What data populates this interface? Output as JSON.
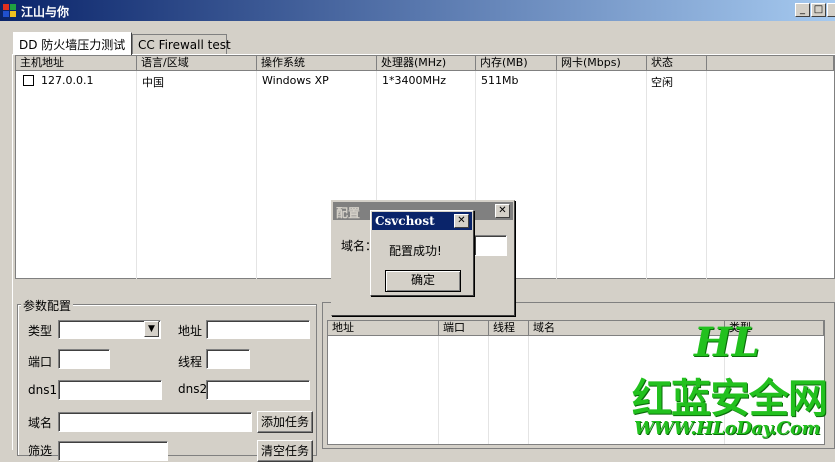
{
  "window": {
    "title": "江山与你",
    "min_label": "_",
    "max_label": "□"
  },
  "tabs": [
    {
      "label": "DD 防火墙压力测试",
      "active": true
    },
    {
      "label": "CC Firewall test",
      "active": false
    }
  ],
  "host_table": {
    "columns": [
      "主机地址",
      "语言/区域",
      "操作系统",
      "处理器(MHz)",
      "内存(MB)",
      "网卡(Mbps)",
      "状态"
    ],
    "rows": [
      {
        "checked": false,
        "cells": [
          "127.0.0.1",
          "中国",
          "Windows XP",
          "1*3400MHz",
          "511Mb",
          "",
          "空闲"
        ]
      }
    ]
  },
  "params": {
    "group_title": "参数配置",
    "type_label": "类型",
    "type_value": "",
    "address_label": "地址",
    "address_value": "",
    "port_label": "端口",
    "port_value": "",
    "threads_label": "线程",
    "threads_value": "",
    "dns1_label": "dns1",
    "dns1_value": "",
    "dns2_label": "dns2",
    "dns2_value": "",
    "domain_label": "域名",
    "domain_value": "",
    "add_task_button": "添加任务",
    "filter_label": "筛选",
    "clear_task_button": "清空任务"
  },
  "task_table": {
    "columns": [
      "地址",
      "端口",
      "线程",
      "域名",
      "类型"
    ]
  },
  "config_dialog": {
    "title": "配置",
    "domain_label": "域名：",
    "domain_value": "",
    "close_label": "✕"
  },
  "message_box": {
    "title": "Csvchost",
    "message": "配置成功!",
    "ok_button": "确定",
    "close_label": "✕"
  },
  "watermark": {
    "line1": "HL",
    "line2": "红蓝安全网",
    "line3": "WWW.HLoDay.Com"
  },
  "colors": {
    "titlebar_active": "#0a246a",
    "titlebar_inactive": "#808080",
    "face": "#d4d0c8",
    "watermark_green": "#22c11e"
  }
}
